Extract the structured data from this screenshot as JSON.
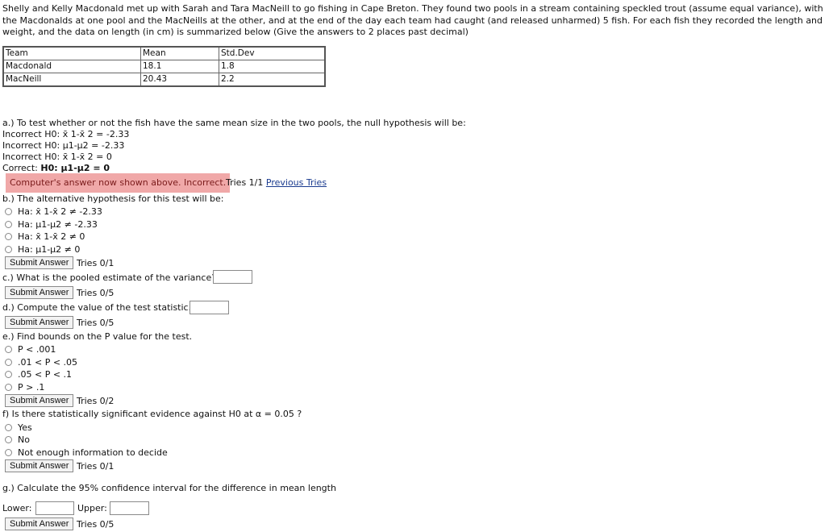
{
  "intro": "Shelly and Kelly Macdonald met up with Sarah and Tara MacNeill to go fishing in Cape Breton. They found two pools in a stream containing speckled trout (assume equal variance), with the Macdonalds at one pool and the MacNeills at the other, and at the end of the day each team had caught (and released unharmed) 5 fish. For each fish they recorded the length and weight, and the data on length (in cm) is summarized below (Give the answers to 2 places past decimal)",
  "table": {
    "headers": [
      "Team",
      "Mean",
      "Std.Dev"
    ],
    "rows": [
      [
        "Macdonald",
        "18.1",
        "1.8"
      ],
      [
        "MacNeill",
        "20.43",
        "2.2"
      ]
    ]
  },
  "part_a": {
    "question": "a.) To test whether or not the fish have the same mean size in the two pools, the null hypothesis will be:",
    "feedback": [
      "Incorrect H0:  x̄ 1-x̄ 2 = -2.33",
      "Incorrect H0:  μ1-μ2 = -2.33",
      "Incorrect H0:  x̄ 1-x̄ 2 = 0"
    ],
    "correct_prefix": "Correct: ",
    "correct_answer": "H0:  μ1-μ2 = 0",
    "status": "Computer's answer now shown above. Incorrect.",
    "tries": "Tries 1/1",
    "previous_tries": "Previous Tries"
  },
  "part_b": {
    "question": "b.) The alternative hypothesis for this test will be:",
    "options": [
      "Ha:  x̄ 1-x̄ 2 ≠ -2.33",
      "Ha:  μ1-μ2 ≠ -2.33",
      "Ha:  x̄ 1-x̄ 2 ≠ 0",
      "Ha:  μ1-μ2 ≠ 0"
    ],
    "submit": "Submit Answer",
    "tries": "Tries 0/1"
  },
  "part_c": {
    "question": "c.) What is the pooled estimate of the variance?",
    "value": "",
    "submit": "Submit Answer",
    "tries": "Tries 0/5"
  },
  "part_d": {
    "question": "d.) Compute the value of the test statistic.",
    "value": "",
    "submit": "Submit Answer",
    "tries": "Tries 0/5"
  },
  "part_e": {
    "question": "e.) Find bounds on the P value for the test.",
    "options": [
      "P < .001",
      ".01 < P < .05",
      ".05 < P < .1",
      "P > .1"
    ],
    "submit": "Submit Answer",
    "tries": "Tries 0/2"
  },
  "part_f": {
    "question": "f) Is there statistically significant evidence against H0  at α = 0.05 ?",
    "options": [
      "Yes",
      "No",
      "Not enough information to decide"
    ],
    "submit": "Submit Answer",
    "tries": "Tries 0/1"
  },
  "part_g": {
    "question": "g.) Calculate the 95% confidence interval for the difference in mean length",
    "lower_label": "Lower:",
    "upper_label": "Upper:",
    "lower_value": "",
    "upper_value": "",
    "submit": "Submit Answer",
    "tries": "Tries 0/5"
  },
  "colors": {
    "incorrect_bg": "#f0a8a8",
    "incorrect_text": "#7a1b1b",
    "link": "#1a3b8f"
  }
}
